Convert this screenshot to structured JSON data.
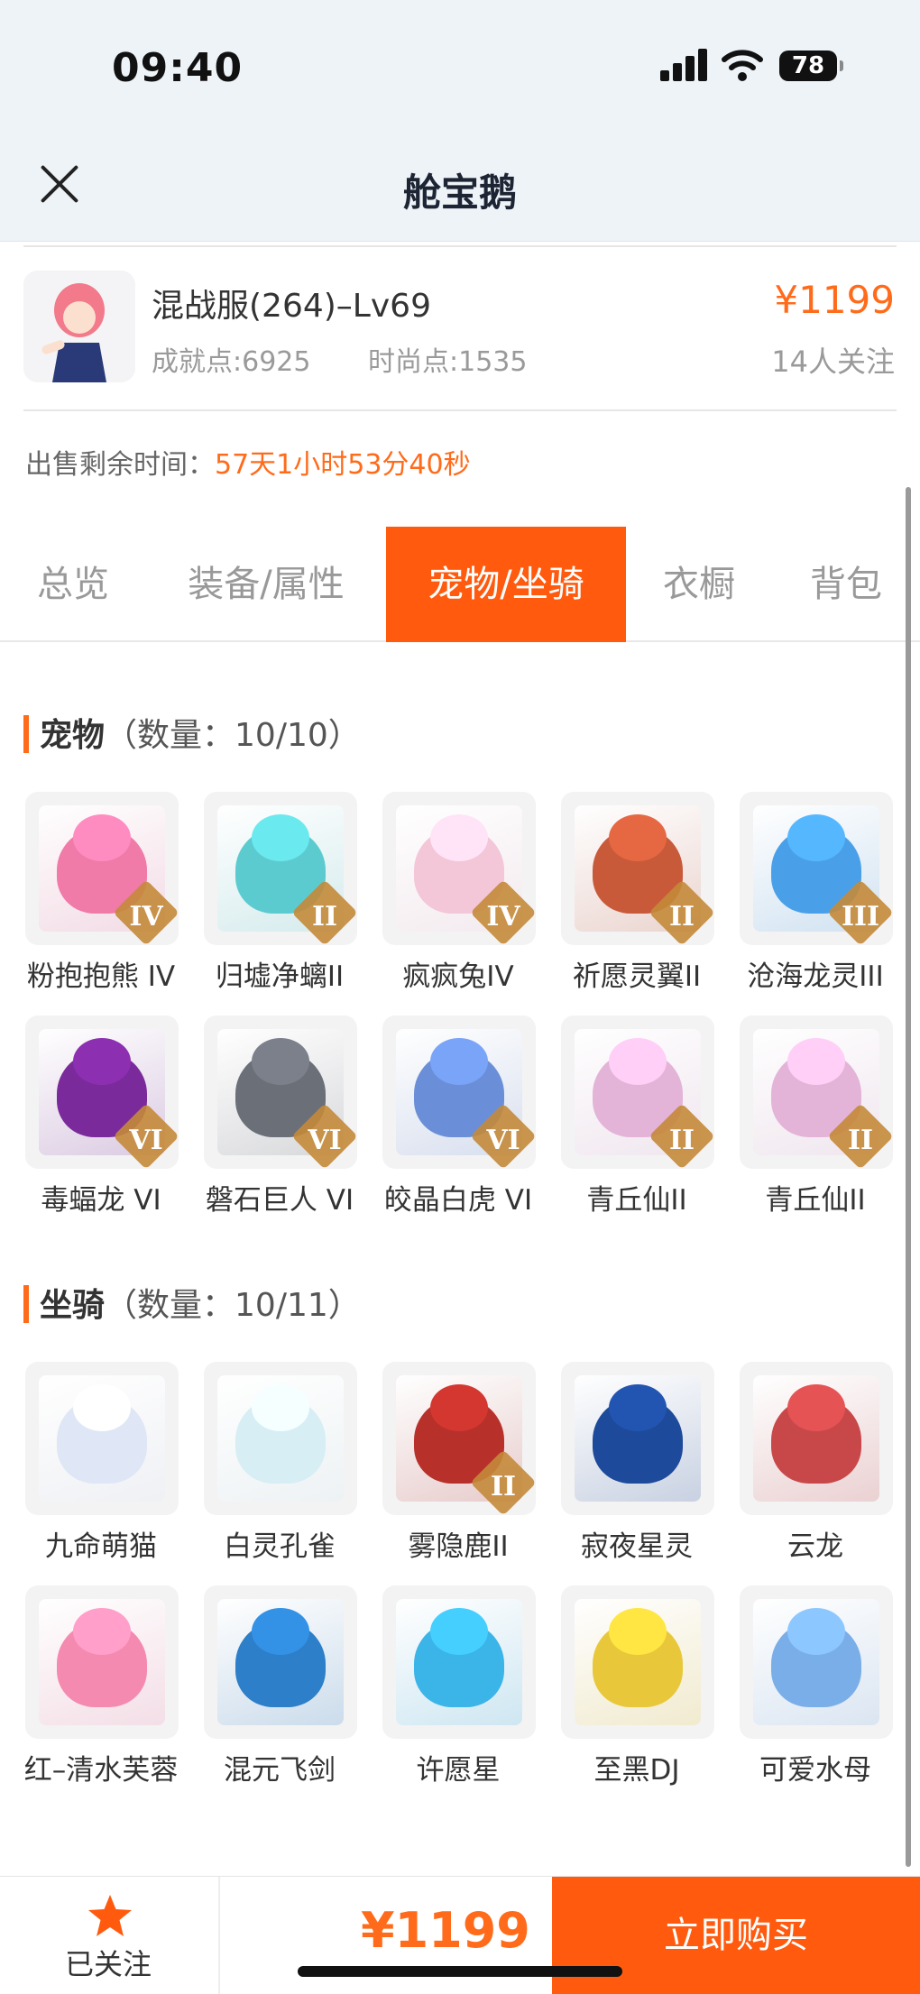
{
  "status": {
    "time": "09:40",
    "battery": "78"
  },
  "nav": {
    "title": "舱宝鹅"
  },
  "listing": {
    "server": "混战服(264)–Lv69",
    "achievement": "成就点:6925",
    "fashion": "时尚点:1535",
    "price": "¥1199",
    "followers": "14人关注",
    "remain_label": "出售剩余时间：",
    "remain_value": "57天1小时53分40秒"
  },
  "tabs": [
    "总览",
    "装备/属性",
    "宠物/坐骑",
    "衣橱",
    "背包"
  ],
  "active_tab": "宠物/坐骑",
  "pets": {
    "title": "宠物",
    "count": "（数量：10/10）",
    "items": [
      {
        "name": "粉抱抱熊 IV",
        "rank": "IV",
        "color": "#f07aa8"
      },
      {
        "name": "归墟净螭II",
        "rank": "II",
        "color": "#5ccbd0"
      },
      {
        "name": "疯疯兔IV",
        "rank": "IV",
        "color": "#f3c6d8"
      },
      {
        "name": "祈愿灵翼II",
        "rank": "II",
        "color": "#c85a3a"
      },
      {
        "name": "沧海龙灵III",
        "rank": "III",
        "color": "#4aa0e8"
      },
      {
        "name": "毒蝠龙 VI",
        "rank": "VI",
        "color": "#7a2a9a"
      },
      {
        "name": "磐石巨人 VI",
        "rank": "VI",
        "color": "#6b6f78"
      },
      {
        "name": "皎晶白虎 VI",
        "rank": "VI",
        "color": "#6a8fd8"
      },
      {
        "name": "青丘仙II",
        "rank": "II",
        "color": "#e3b4d8"
      },
      {
        "name": "青丘仙II",
        "rank": "II",
        "color": "#e3b4d8"
      }
    ]
  },
  "mounts": {
    "title": "坐骑",
    "count": "（数量：10/11）",
    "items": [
      {
        "name": "九命萌猫",
        "rank": "",
        "color": "#dfe6f5"
      },
      {
        "name": "白灵孔雀",
        "rank": "",
        "color": "#d6eef4"
      },
      {
        "name": "雾隐鹿II",
        "rank": "II",
        "color": "#b8302a"
      },
      {
        "name": "寂夜星灵",
        "rank": "",
        "color": "#1d4a9a"
      },
      {
        "name": "云龙",
        "rank": "",
        "color": "#c8484a"
      },
      {
        "name": "红–清水芙蓉",
        "rank": "",
        "color": "#f48ab0"
      },
      {
        "name": "混元飞剑",
        "rank": "",
        "color": "#2c7fc8"
      },
      {
        "name": "许愿星",
        "rank": "",
        "color": "#3bb4e8"
      },
      {
        "name": "至黑DJ",
        "rank": "",
        "color": "#e8c83a"
      },
      {
        "name": "可爱水母",
        "rank": "",
        "color": "#7aaee8"
      }
    ]
  },
  "bottom": {
    "followed": "已关注",
    "price": "¥1199",
    "buy": "立即购买"
  },
  "colors": {
    "accent": "#ff5a0d",
    "price": "#ff6b1a"
  }
}
